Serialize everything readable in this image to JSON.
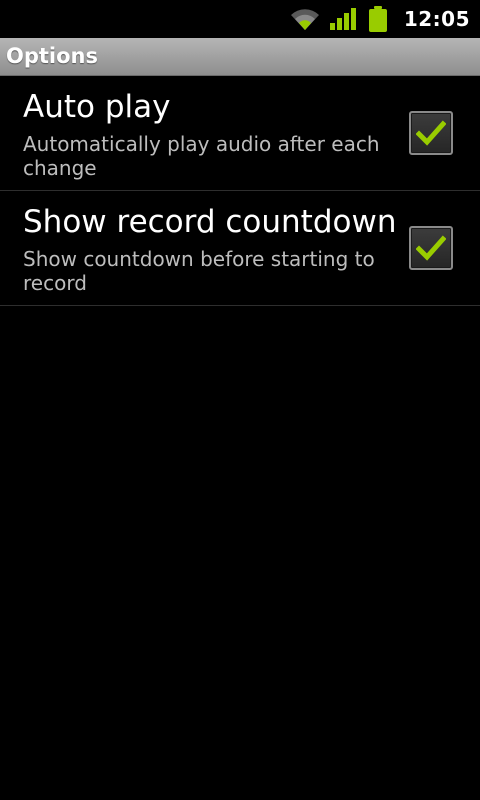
{
  "status_bar": {
    "time": "12:05",
    "icons": [
      "wifi-icon",
      "signal-icon",
      "battery-icon"
    ],
    "accent_color": "#99cc00"
  },
  "title_bar": {
    "title": "Options"
  },
  "preferences": [
    {
      "title": "Auto play",
      "summary": "Automatically play audio after each change",
      "checked": true
    },
    {
      "title": "Show record countdown",
      "summary": "Show countdown before starting to record",
      "checked": true
    }
  ]
}
